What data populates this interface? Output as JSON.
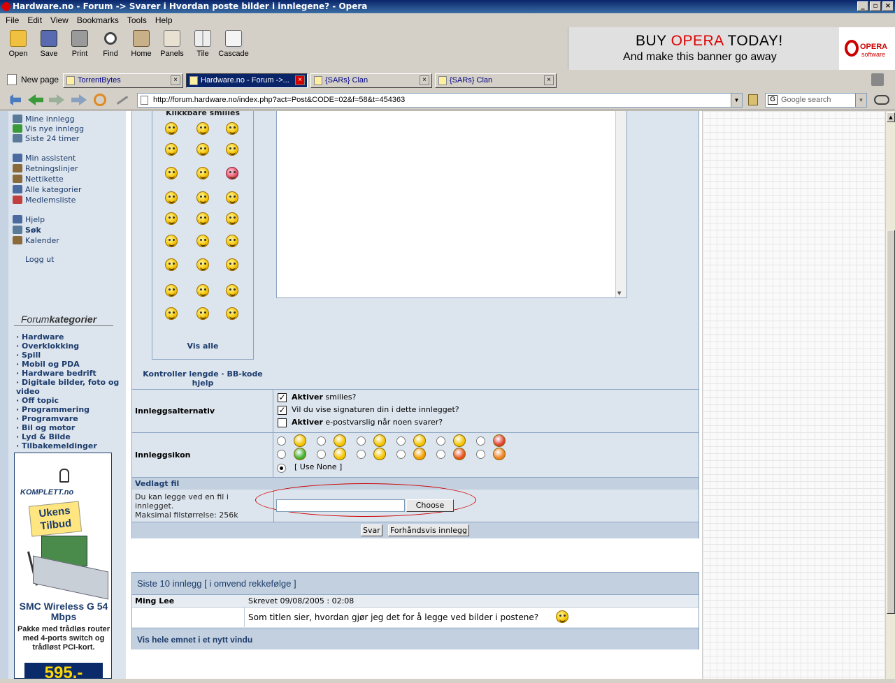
{
  "window": {
    "title": "Hardware.no - Forum -> Svarer i Hvordan poste bilder i innlegene? - Opera",
    "controls": [
      "_",
      "▫",
      "×"
    ]
  },
  "menu": [
    "File",
    "Edit",
    "View",
    "Bookmarks",
    "Tools",
    "Help"
  ],
  "toolbar": {
    "buttons": [
      {
        "label": "Open",
        "icon": "folder-icon"
      },
      {
        "label": "Save",
        "icon": "floppy-icon"
      },
      {
        "label": "Print",
        "icon": "printer-icon"
      },
      {
        "label": "Find",
        "icon": "magnifier-icon"
      },
      {
        "label": "Home",
        "icon": "home-icon"
      },
      {
        "label": "Panels",
        "icon": "panels-icon"
      },
      {
        "label": "Tile",
        "icon": "tile-icon"
      },
      {
        "label": "Cascade",
        "icon": "cascade-icon"
      }
    ]
  },
  "banner": {
    "line1_a": "BUY ",
    "line1_b": "OPERA",
    "line1_c": " TODAY!",
    "line2": "And make this banner go away",
    "logo_text": "OPERA",
    "logo_sub": "software"
  },
  "tabs": {
    "new_page": "New page",
    "items": [
      {
        "label": "TorrentBytes",
        "active": false
      },
      {
        "label": "Hardware.no - Forum ->...",
        "active": true
      },
      {
        "label": "{SARs} Clan",
        "active": false
      },
      {
        "label": "{SARs} Clan",
        "active": false
      }
    ]
  },
  "address": {
    "url": "http://forum.hardware.no/index.php?act=Post&CODE=02&f=58&t=454363",
    "search_placeholder": "Google search"
  },
  "sidebar": {
    "links_group1": [
      {
        "label": "Mine innlegg",
        "color": "#5a7a9a"
      },
      {
        "label": "Vis nye innlegg",
        "color": "#3a9a3a"
      },
      {
        "label": "Siste 24 timer",
        "color": "#5a7a9a"
      }
    ],
    "links_group2": [
      {
        "label": "Min assistent",
        "color": "#4a6aa0"
      },
      {
        "label": "Retningslinjer",
        "color": "#8a6a3a"
      },
      {
        "label": "Nettikette",
        "color": "#8a6a3a"
      },
      {
        "label": "Alle kategorier",
        "color": "#4a6aa0"
      },
      {
        "label": "Medlemsliste",
        "color": "#c04040"
      }
    ],
    "links_group3": [
      {
        "label": "Hjelp",
        "color": "#4a6aa0",
        "bold": false
      },
      {
        "label": "Søk",
        "color": "#5a7a9a",
        "bold": true
      },
      {
        "label": "Kalender",
        "color": "#8a6a3a",
        "bold": false
      }
    ],
    "logout": "Logg ut",
    "forum_title_a": "Forum",
    "forum_title_b": "kategorier",
    "categories": [
      "· Hardware",
      "· Overklokking",
      "· Spill",
      "· Mobil og PDA",
      "· Hardware bedrift",
      "· Digitale bilder, foto og video",
      "· Off topic",
      "· Programmering",
      "· Programvare",
      "· Bil og motor",
      "· Lyd & Bilde",
      "· Tilbakemeldinger"
    ],
    "ad": {
      "brand": "KOMPLETT.no",
      "tag": "Ukens Tilbud",
      "product": "SMC Wireless G 54 Mbps",
      "description": "Pakke med trådløs router med 4-ports switch og trådløst PCI-kort.",
      "price": "595,-"
    }
  },
  "editor": {
    "smilies_header": "Klikkbare smilies",
    "vis_alle": "Vis alle",
    "kontroller": "Kontroller lengde · BB-kode hjelp"
  },
  "options": {
    "label": "Innleggsalternativ",
    "items": [
      {
        "bold": "Aktiver",
        "rest": " smilies?",
        "checked": true
      },
      {
        "bold": "",
        "rest": "Vil du vise signaturen din i dette innlegget?",
        "checked": true
      },
      {
        "bold": "Aktiver",
        "rest": " e-postvarslig når noen svarer?",
        "checked": false
      }
    ]
  },
  "icons": {
    "label": "Innleggsikon",
    "use_none": "[ Use None ]"
  },
  "attachment": {
    "header": "Vedlagt fil",
    "line1": "Du kan legge ved en fil i",
    "line2": "innlegget.",
    "line3": "Maksimal filstørrelse: 256k",
    "choose": "Choose"
  },
  "buttons": {
    "svar": "Svar",
    "preview": "Forhåndsvis innlegg"
  },
  "last_posts": {
    "header": "Siste 10 innlegg [ i omvend rekkefølge ]",
    "author": "Ming Lee",
    "date": "Skrevet 09/08/2005 : 02:08",
    "body": "Som titlen sier, hvordan gjør jeg det for å legge ved bilder i postene?",
    "footer": "Vis hele emnet i et nytt vindu"
  }
}
